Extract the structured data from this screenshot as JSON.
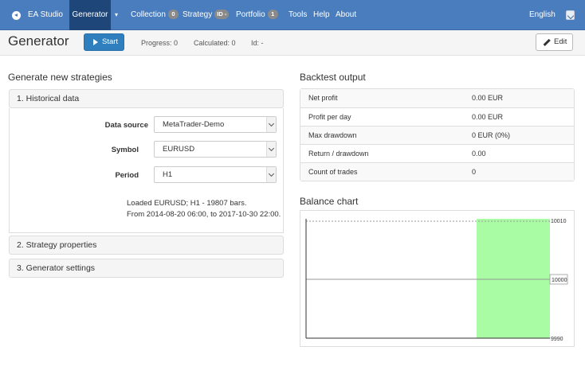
{
  "nav": {
    "brand": "EA Studio",
    "generator": "Generator",
    "collection": "Collection",
    "collection_badge": "0",
    "strategy": "Strategy",
    "strategy_badge": "ID -",
    "portfolio": "Portfolio",
    "portfolio_badge": "1",
    "tools": "Tools",
    "help": "Help",
    "about": "About",
    "language": "English"
  },
  "toolbar": {
    "title": "Generator",
    "start_label": "Start",
    "progress": "Progress: 0",
    "calculated": "Calculated: 0",
    "id": "Id: -",
    "edit_label": "Edit"
  },
  "generate": {
    "heading": "Generate new strategies",
    "panels": [
      "1. Historical data",
      "2. Strategy properties",
      "3. Generator settings"
    ],
    "data_source_label": "Data source",
    "data_source_value": "MetaTrader-Demo",
    "symbol_label": "Symbol",
    "symbol_value": "EURUSD",
    "period_label": "Period",
    "period_value": "H1",
    "loaded_line1": "Loaded EURUSD; H1 - 19807 bars.",
    "loaded_line2": "From 2014-08-20 06:00, to 2017-10-30 22:00."
  },
  "backtest": {
    "heading": "Backtest output",
    "rows": [
      {
        "label": "Net profit",
        "value": "0.00 EUR"
      },
      {
        "label": "Profit per day",
        "value": "0.00 EUR"
      },
      {
        "label": "Max drawdown",
        "value": "0 EUR (0%)"
      },
      {
        "label": "Return / drawdown",
        "value": "0.00"
      },
      {
        "label": "Count of trades",
        "value": "0"
      }
    ]
  },
  "balance": {
    "heading": "Balance chart",
    "y_top": "10010",
    "y_mid": "10000",
    "y_bottom": "9990",
    "highlight_color": "#a9fca4",
    "line_color": "#999999"
  },
  "colors": {
    "navbar": "#4a7dbe",
    "nav_active": "#1e4678",
    "primary_button": "#2f7fbf"
  }
}
